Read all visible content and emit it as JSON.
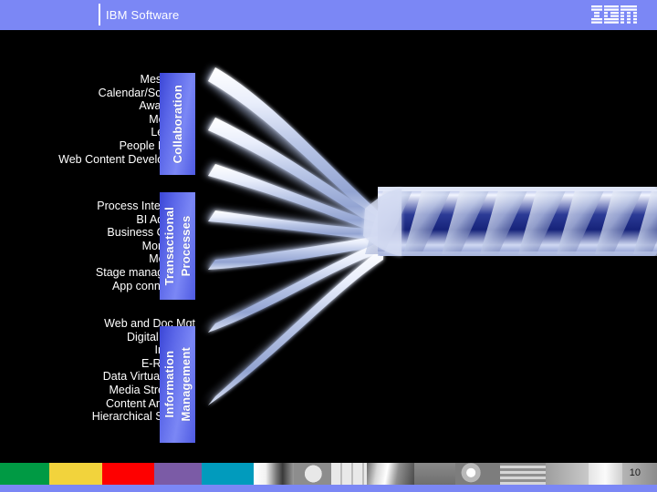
{
  "header": {
    "title": "IBM Software",
    "logo_alt": "IBM",
    "band_color": "#7b87f5"
  },
  "categories": [
    {
      "id": "collab",
      "tab_label": "Collaboration",
      "tab_lines": [
        "Collaboration"
      ],
      "items": [
        "Messaging",
        "Calendar/Schedule",
        "Awareness",
        "Meetings",
        "Learning",
        "People Finding",
        "Web Content Development"
      ]
    },
    {
      "id": "trans",
      "tab_label": "Transactional Processes",
      "tab_lines": [
        "Transactional",
        "Processes"
      ],
      "items": [
        "Process Integration",
        "BI Adapters",
        "Business Objects",
        "Monitoring",
        "Modeling",
        "Stage management",
        "App connectivity"
      ]
    },
    {
      "id": "info",
      "tab_label": "Information Management",
      "tab_lines": [
        "Information",
        "Management"
      ],
      "items": [
        "Web and Doc Mgt",
        "Digital Assets",
        "Imaging",
        "E-Records",
        "Data Virtualization",
        "Media Streaming",
        "Content Archiving",
        "Hierarchical Storage"
      ]
    }
  ],
  "graphic": {
    "name": "converging-fiber-rope",
    "description": "Multiple light blue fiber strands fan out to the left and twist together into a single braided blue and white cable extending to the right edge",
    "strand_count": 7,
    "strand_color": "#c6d2ee",
    "rope_dark_color": "#1b2a7a",
    "rope_light_color": "#eef2ff"
  },
  "footer": {
    "page_number": "10",
    "accent_color": "#7b87f5",
    "swatches": [
      {
        "name": "green",
        "color": "#009a44",
        "width": 64
      },
      {
        "name": "yellow",
        "color": "#f2d33c",
        "width": 70
      },
      {
        "name": "red",
        "color": "#fe0000",
        "width": 68
      },
      {
        "name": "purple",
        "color": "#7b5ba6",
        "width": 62
      },
      {
        "name": "cyan",
        "color": "#019bbd",
        "width": 68
      }
    ]
  }
}
